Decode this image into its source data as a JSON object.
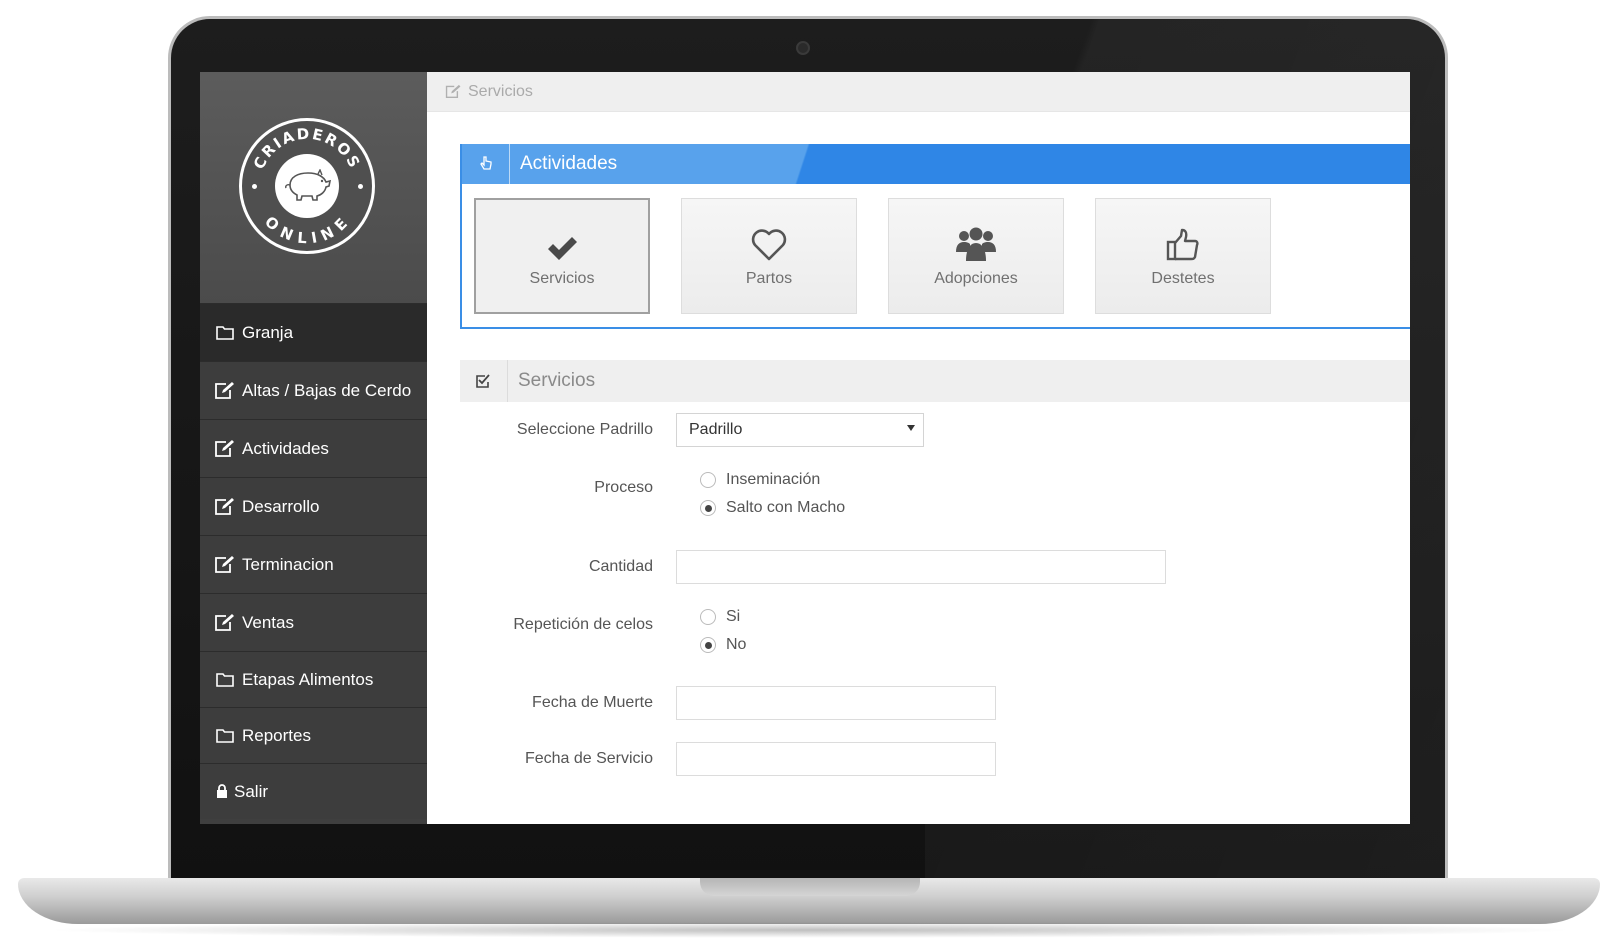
{
  "logo": {
    "text_top": "CRIADEROS",
    "text_bottom": "ONLINE"
  },
  "sidebar": {
    "items": [
      {
        "label": "Granja",
        "icon": "folder-icon",
        "active": true
      },
      {
        "label": "Altas / Bajas de Cerdo",
        "icon": "edit-icon"
      },
      {
        "label": "Actividades",
        "icon": "edit-icon"
      },
      {
        "label": "Desarrollo",
        "icon": "edit-icon"
      },
      {
        "label": "Terminacion",
        "icon": "edit-icon"
      },
      {
        "label": "Ventas",
        "icon": "edit-icon"
      },
      {
        "label": "Etapas Alimentos",
        "icon": "folder-icon"
      },
      {
        "label": "Reportes",
        "icon": "folder-icon"
      },
      {
        "label": "Salir",
        "icon": "lock-icon"
      }
    ]
  },
  "breadcrumb": {
    "label": "Servicios",
    "icon": "edit-icon"
  },
  "actividades": {
    "title": "Actividades",
    "icon": "hand-pointer-icon",
    "tiles": [
      {
        "label": "Servicios",
        "icon": "check-icon",
        "selected": true
      },
      {
        "label": "Partos",
        "icon": "heart-icon"
      },
      {
        "label": "Adopciones",
        "icon": "users-icon"
      },
      {
        "label": "Destetes",
        "icon": "thumbs-up-icon"
      }
    ]
  },
  "servicios": {
    "title": "Servicios",
    "icon": "check-square-icon",
    "padrillo": {
      "label": "Seleccione Padrillo",
      "value": "Padrillo"
    },
    "proceso": {
      "label": "Proceso",
      "options": [
        "Inseminación",
        "Salto con Macho"
      ],
      "selected": "Salto con Macho"
    },
    "cantidad": {
      "label": "Cantidad",
      "value": ""
    },
    "repeticion": {
      "label": "Repetición de celos",
      "options": [
        "Si",
        "No"
      ],
      "selected": "No"
    },
    "fecha_muerte": {
      "label": "Fecha de Muerte",
      "value": ""
    },
    "fecha_servicio": {
      "label": "Fecha de Servicio",
      "value": ""
    }
  },
  "colors": {
    "accent": "#2f86e6",
    "sidebar": "#3d3d3d",
    "sidebar_active": "#2a2a2a"
  }
}
